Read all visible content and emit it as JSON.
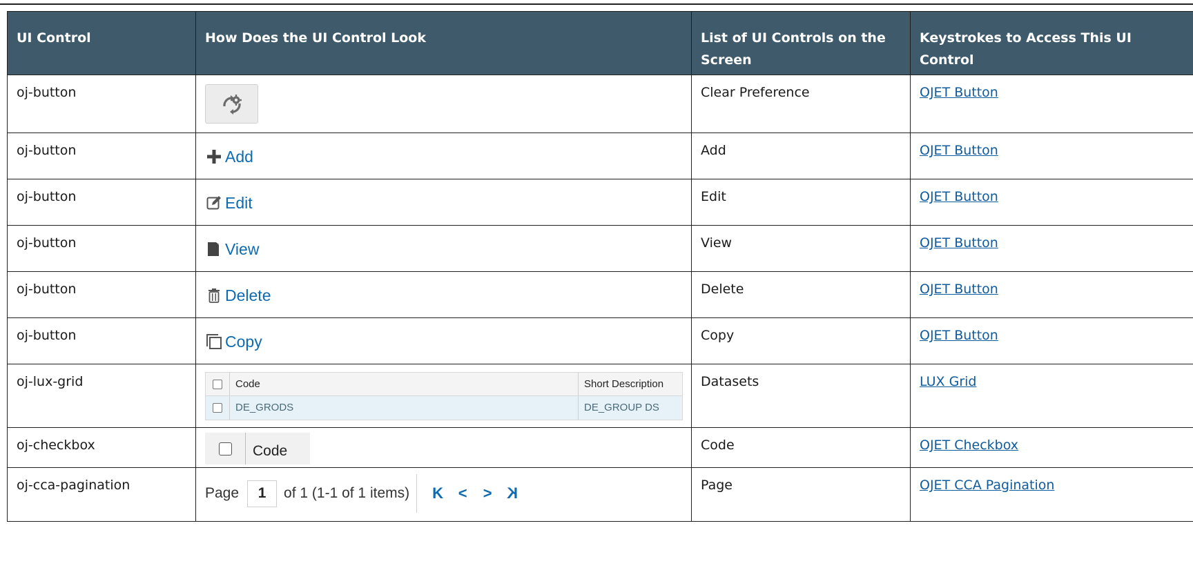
{
  "table": {
    "headers": {
      "ui_control": "UI Control",
      "look": "How Does the UI Control Look",
      "list": "List of UI Controls on the Screen",
      "keystrokes": "Keystrokes to Access This UI Control"
    },
    "rows": [
      {
        "control": "oj-button",
        "screen_name": "Clear Preference",
        "link": "OJET Button",
        "icon": "clear-preference-icon"
      },
      {
        "control": "oj-button",
        "button_label": "Add",
        "screen_name": "Add",
        "link": "OJET Button",
        "icon": "plus-icon"
      },
      {
        "control": "oj-button",
        "button_label": "Edit",
        "screen_name": "Edit",
        "link": "OJET Button",
        "icon": "edit-icon"
      },
      {
        "control": "oj-button",
        "button_label": "View",
        "screen_name": "View",
        "link": "OJET Button",
        "icon": "view-icon"
      },
      {
        "control": "oj-button",
        "button_label": "Delete",
        "screen_name": "Delete",
        "link": "OJET Button",
        "icon": "trash-icon"
      },
      {
        "control": "oj-button",
        "button_label": "Copy",
        "screen_name": "Copy",
        "link": "OJET Button",
        "icon": "copy-icon"
      },
      {
        "control": "oj-lux-grid",
        "grid": {
          "col_code": "Code",
          "col_desc": "Short Description",
          "cell_code": "DE_GRODS",
          "cell_desc": "DE_GROUP DS"
        },
        "screen_name": "Datasets",
        "link": "LUX Grid"
      },
      {
        "control": "oj-checkbox",
        "checkbox_label": "Code",
        "screen_name": "Code",
        "link": "OJET Checkbox"
      },
      {
        "control": "oj-cca-pagination",
        "pager": {
          "page_label": "Page",
          "page_value": "1",
          "summary": "of 1 (1-1 of 1 items)",
          "first": "K",
          "prev": "<",
          "next": ">",
          "last": "K"
        },
        "screen_name": "Page",
        "link": "OJET CCA Pagination"
      }
    ]
  },
  "colors": {
    "header_bg": "#3f5b6b",
    "link": "#0f5b9c",
    "button_text": "#0f6bb0",
    "grid_row_bg": "#e6f2f8"
  }
}
